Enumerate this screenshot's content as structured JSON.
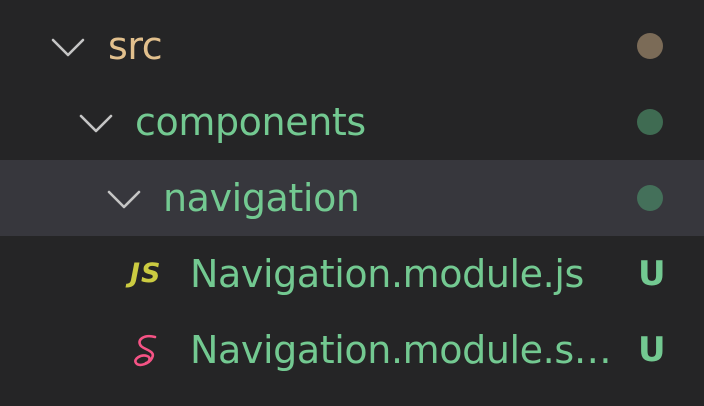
{
  "tree": {
    "rows": [
      {
        "label": "src",
        "expanded": true,
        "status": "dot",
        "dot_color": "#7b6b57"
      },
      {
        "label": "components",
        "expanded": true,
        "status": "dot",
        "dot_color": "#3f6b52"
      },
      {
        "label": "navigation",
        "expanded": true,
        "selected": true,
        "status": "dot",
        "dot_color": "#44705a"
      },
      {
        "label": "Navigation.module.js",
        "icon": "javascript-file-icon",
        "icon_text": "JS",
        "icon_color": "#cbcb41",
        "status": "U",
        "status_color": "#73c991"
      },
      {
        "label": "Navigation.module.s…",
        "icon": "sass-file-icon",
        "icon_color": "#f55385",
        "status": "U",
        "status_color": "#73c991"
      }
    ]
  },
  "colors": {
    "background": "#252526",
    "selected_row": "#37373d",
    "folder_modified": "#e2c08d",
    "untracked": "#73c991",
    "chevron": "#c5c5c5"
  }
}
